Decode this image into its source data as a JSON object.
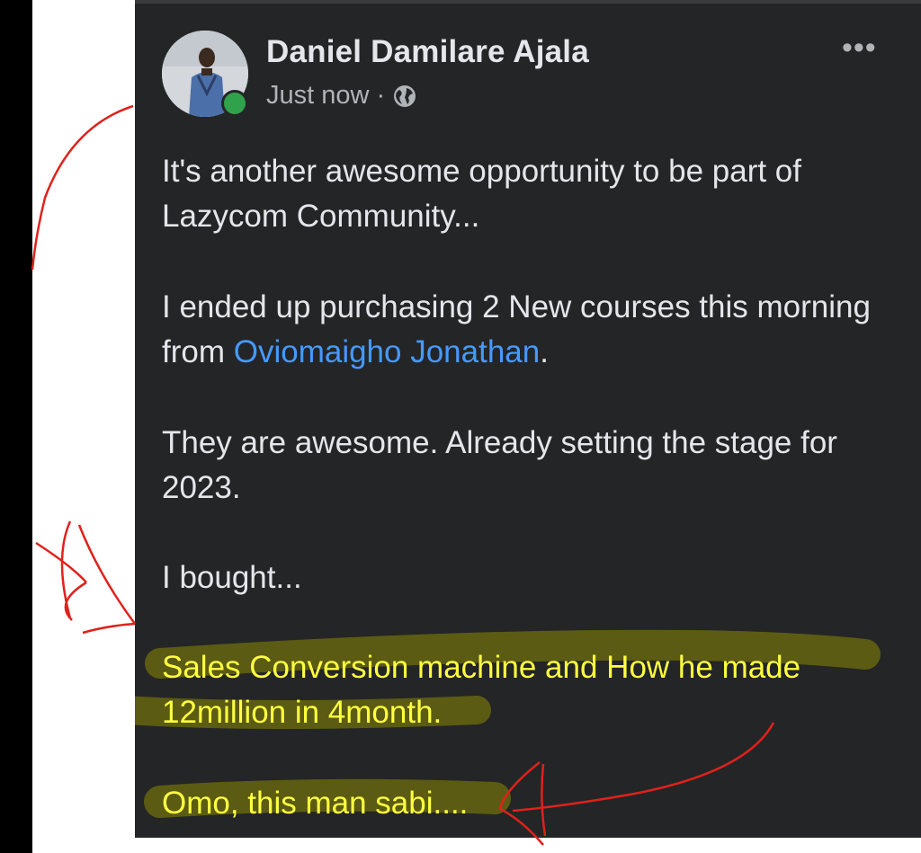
{
  "post": {
    "author_name": "Daniel Damilare Ajala",
    "timestamp": "Just now",
    "separator": "·",
    "privacy_icon": "globe-icon",
    "more_label": "•••",
    "paragraphs": {
      "p1": "It's another awesome opportunity to be part of Lazycom Community...",
      "p2_before": "I ended up purchasing 2 New courses this morning from ",
      "p2_mention": "Oviomaigho Jonathan",
      "p2_after": ".",
      "p3": "They are awesome. Already setting the stage for 2023.",
      "p4": "I bought...",
      "p5_line1": "Sales Conversion machine and How he made",
      "p5_line2": "12million in 4month.",
      "p6": "Omo, this man sabi...."
    }
  },
  "colors": {
    "card_bg": "#242526",
    "text": "#e4e6eb",
    "secondary_text": "#b0b3b8",
    "mention": "#4599ff",
    "highlight_text": "#ffff40",
    "highlighter_marker": "#7d7d10",
    "annotation_red": "#e0211c",
    "online_green": "#31a24c"
  }
}
